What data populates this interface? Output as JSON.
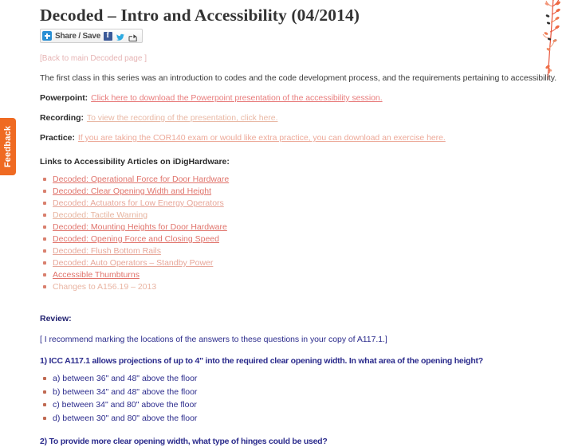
{
  "slide": {
    "title": "Decoded – Intro and Accessibility (04/2014)",
    "back_link": "[Back to main Decoded page ]",
    "intro": "The first class in this series was an introduction to codes and the code development process, and the requirements pertaining to accessibility.",
    "share": {
      "label": "Share / Save",
      "plus_icon": "plus-icon",
      "facebook_icon": "facebook-icon",
      "twitter_icon": "twitter-icon",
      "share_icon": "share-arrow-icon"
    },
    "resources": [
      {
        "label": "Powerpoint:",
        "link": "Click here to download the Powerpoint presentation of the accessibility session."
      },
      {
        "label": "Recording:",
        "link": "To view the recording of the presentation, click here."
      },
      {
        "label": "Practice:",
        "link": "If you are taking the COR140 exam or would like extra practice, you can download an exercise here."
      }
    ],
    "articles_heading": "Links to Accessibility Articles on iDigHardware:",
    "articles": [
      "Decoded: Operational Force for Door Hardware",
      "Decoded: Clear Opening Width and Height",
      "Decoded: Actuators for Low Energy Operators",
      "Decoded: Tactile Warning",
      "Decoded: Mounting Heights for Door Hardware",
      "Decoded: Opening Force and Closing Speed",
      "Decoded: Flush Bottom Rails",
      "Decoded: Auto Operators – Standby Power",
      "Accessible Thumbturns",
      "Changes to A156.19 – 2013"
    ],
    "review_heading": "Review:",
    "review_note": "[ I recommend marking the locations of the answers to these questions in your copy of A117.1.]",
    "question_1": "1) ICC A117.1 allows projections of up to 4\" into the required clear opening width. In what area of the opening height?",
    "answers_1": [
      "a) between 36\" and 48\" above the floor",
      "b) between 34\" and 48\" above the floor",
      "c) between 34\" and 80\" above the floor",
      "d) between 30\" and 80\" above the floor"
    ],
    "question_2": "2) To provide more clear opening width, what type of hinges could be used?"
  },
  "feedback_tab": {
    "label": "Feedback",
    "color": "#ef6a22"
  },
  "decoration": {
    "vine_icon": "vine-branch-decoration",
    "color": "#e8533a"
  }
}
